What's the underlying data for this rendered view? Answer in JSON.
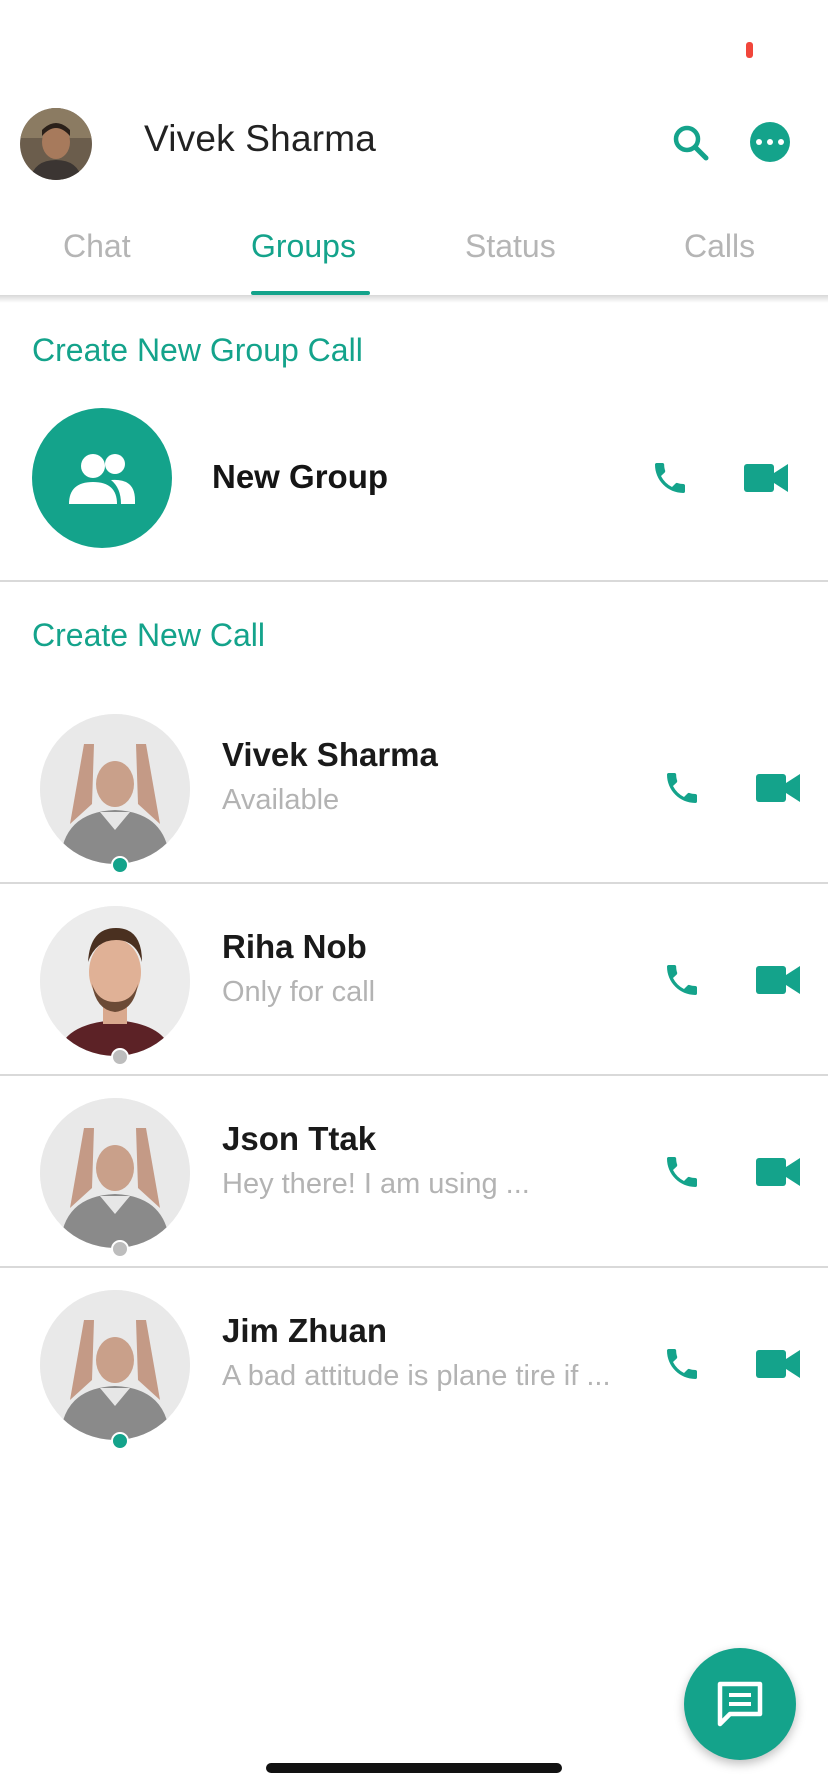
{
  "header": {
    "title": "Vivek Sharma",
    "avatar": "user-avatar-photo"
  },
  "tabs": [
    {
      "label": "Chat",
      "active": false
    },
    {
      "label": "Groups",
      "active": true
    },
    {
      "label": "Status",
      "active": false
    },
    {
      "label": "Calls",
      "active": false
    }
  ],
  "group_section": {
    "title": "Create New Group Call",
    "new_group_label": "New Group"
  },
  "call_section": {
    "title": "Create New Call"
  },
  "contacts": [
    {
      "name": "Vivek Sharma",
      "status": "Available",
      "online": true
    },
    {
      "name": "Riha Nob",
      "status": "Only for call",
      "online": false
    },
    {
      "name": "Json Ttak",
      "status": "Hey there! I am using ...",
      "online": false
    },
    {
      "name": "Jim Zhuan",
      "status": "A bad attitude is plane tire if ...",
      "online": true
    }
  ],
  "colors": {
    "accent": "#14a38b",
    "tab_inactive": "#b5b5b5",
    "status_text": "#b3b3b3",
    "offline_dot": "#bdbdbd",
    "battery": "#f1463b"
  },
  "icons": {
    "search": "search-icon",
    "more": "more-horizontal-icon",
    "group": "group-icon",
    "phone": "phone-icon",
    "video": "video-camera-icon",
    "fab": "message-icon"
  }
}
